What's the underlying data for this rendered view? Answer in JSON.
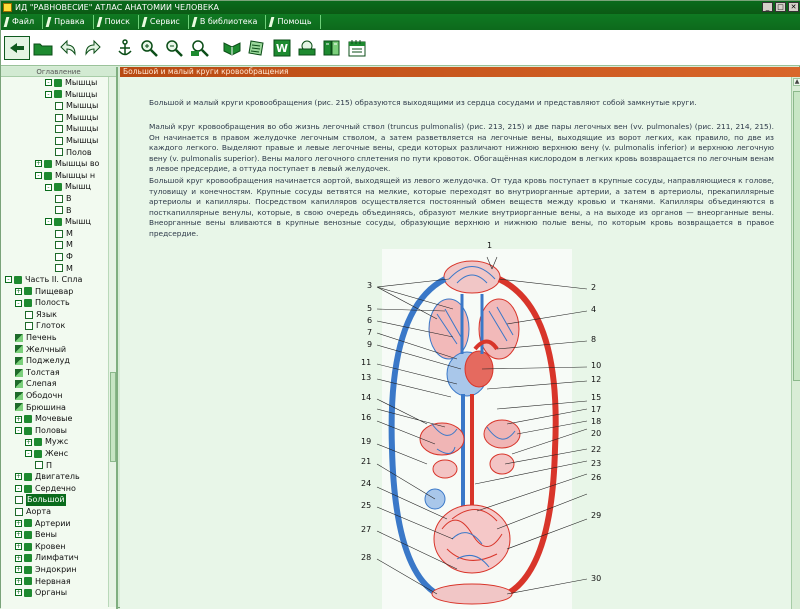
{
  "window": {
    "title": "ИД \"РАВНОВЕСИЕ\" АТЛАС АНАТОМИИ ЧЕЛОВЕКА",
    "minimize": "_",
    "maximize": "□",
    "close": "✕"
  },
  "menu": [
    "Файл",
    "Правка",
    "Поиск",
    "Сервис",
    "В библиотека",
    "Помощь"
  ],
  "toolbar": {
    "icons": [
      "exit-icon",
      "folder-open-icon",
      "back-icon",
      "forward-icon",
      "anchor-icon",
      "zoom-in-icon",
      "zoom-out-icon",
      "search-icon",
      "book-icon",
      "notes-icon",
      "word-icon",
      "print-icon",
      "library-icon",
      "calendar-icon"
    ]
  },
  "sidebar": {
    "header": "Оглавление",
    "items": [
      {
        "label": "Мышцы",
        "level": 4,
        "icon": "folder",
        "expand": "-"
      },
      {
        "label": "Мышцы",
        "level": 4,
        "icon": "folder",
        "expand": "-"
      },
      {
        "label": "Мышцы",
        "level": 5,
        "icon": "doc",
        "expand": ""
      },
      {
        "label": "Мышцы",
        "level": 5,
        "icon": "doc",
        "expand": ""
      },
      {
        "label": "Мышцы",
        "level": 5,
        "icon": "doc",
        "expand": ""
      },
      {
        "label": "Мышцы",
        "level": 5,
        "icon": "doc",
        "expand": ""
      },
      {
        "label": "Полов",
        "level": 5,
        "icon": "doc",
        "expand": ""
      },
      {
        "label": "Мышцы во",
        "level": 3,
        "icon": "folder",
        "expand": "+"
      },
      {
        "label": "Мышцы н",
        "level": 3,
        "icon": "folder",
        "expand": "-"
      },
      {
        "label": "Мышц",
        "level": 4,
        "icon": "folder",
        "expand": "-"
      },
      {
        "label": "В",
        "level": 5,
        "icon": "doc",
        "expand": ""
      },
      {
        "label": "В",
        "level": 5,
        "icon": "doc",
        "expand": ""
      },
      {
        "label": "Мышц",
        "level": 4,
        "icon": "folder",
        "expand": "-"
      },
      {
        "label": "М",
        "level": 5,
        "icon": "doc",
        "expand": ""
      },
      {
        "label": "М",
        "level": 5,
        "icon": "doc",
        "expand": ""
      },
      {
        "label": "Ф",
        "level": 5,
        "icon": "doc",
        "expand": ""
      },
      {
        "label": "М",
        "level": 5,
        "icon": "doc",
        "expand": ""
      },
      {
        "label": "Часть II. Спла",
        "level": 0,
        "icon": "folder",
        "expand": "-"
      },
      {
        "label": "Пищевар",
        "level": 1,
        "icon": "folder",
        "expand": "+"
      },
      {
        "label": "Полость",
        "level": 1,
        "icon": "folder",
        "expand": "-"
      },
      {
        "label": "Язык",
        "level": 2,
        "icon": "doc",
        "expand": ""
      },
      {
        "label": "Глоток",
        "level": 2,
        "icon": "doc",
        "expand": ""
      },
      {
        "label": "Печень",
        "level": 1,
        "icon": "hour",
        "expand": ""
      },
      {
        "label": "Желчный",
        "level": 1,
        "icon": "hour",
        "expand": ""
      },
      {
        "label": "Поджелуд",
        "level": 1,
        "icon": "hour",
        "expand": ""
      },
      {
        "label": "Толстая",
        "level": 1,
        "icon": "hour",
        "expand": ""
      },
      {
        "label": "Слепая",
        "level": 1,
        "icon": "hour",
        "expand": ""
      },
      {
        "label": "Ободочн",
        "level": 1,
        "icon": "hour",
        "expand": ""
      },
      {
        "label": "Брюшина",
        "level": 1,
        "icon": "hour",
        "expand": ""
      },
      {
        "label": "Мочевые",
        "level": 1,
        "icon": "folder",
        "expand": "+"
      },
      {
        "label": "Половы",
        "level": 1,
        "icon": "folder",
        "expand": "-"
      },
      {
        "label": "Мужс",
        "level": 2,
        "icon": "folder",
        "expand": "+"
      },
      {
        "label": "Женс",
        "level": 2,
        "icon": "folder",
        "expand": "-"
      },
      {
        "label": "П",
        "level": 3,
        "icon": "doc",
        "expand": ""
      },
      {
        "label": "Двигатель",
        "level": 1,
        "icon": "folder",
        "expand": "+"
      },
      {
        "label": "Сердечно",
        "level": 1,
        "icon": "folder",
        "expand": "-"
      },
      {
        "label": "Большой",
        "level": 1,
        "icon": "doc",
        "expand": "",
        "selected": true
      },
      {
        "label": "Аорта",
        "level": 1,
        "icon": "doc",
        "expand": ""
      },
      {
        "label": "Артерии",
        "level": 1,
        "icon": "folder",
        "expand": "+"
      },
      {
        "label": "Вены",
        "level": 1,
        "icon": "folder",
        "expand": "+"
      },
      {
        "label": "Кровен",
        "level": 1,
        "icon": "folder",
        "expand": "+"
      },
      {
        "label": "Лимфатич",
        "level": 1,
        "icon": "folder",
        "expand": "+"
      },
      {
        "label": "Эндокрин",
        "level": 1,
        "icon": "folder",
        "expand": "+"
      },
      {
        "label": "Нервная",
        "level": 1,
        "icon": "folder",
        "expand": "+"
      },
      {
        "label": "Органы",
        "level": 1,
        "icon": "folder",
        "expand": "+"
      }
    ]
  },
  "content": {
    "header": "Большой и малый круги кровообращения",
    "paragraphs": [
      "Большой и малый круги кровообращения (рис. 215) образуются выходящими из сердца сосудами и представляют собой замкнутые круги.",
      "Малый круг кровообращения во обо жизнь легочный ствол (truncus pulmonalis) (рис. 213, 215) и две пары легочных вен (vv. pulmonales) (рис. 211, 214, 215). Он начинается в правом желудочке легочным стволом, а затем разветвляется на легочные вены, выходящие из ворот легких, как правило, по две из каждого легкого. Выделяют правые и левые легочные вены, среди которых различают нижнюю верхнюю вену (v. pulmonalis inferior) и верхнюю легочную вену (v. pulmonalis superior). Вены малого легочного сплетения по пути кровоток. Обогащённая кислородом в легких кровь возвращается по легочным венам в левое предсердие, а оттуда поступает в левый желудочек.",
      "Большой круг кровообращения начинается аортой, выходящей из левого желудочка. От туда кровь поступает в крупные сосуды, направляющиеся к голове, туловищу и конечностям. Крупные сосуды ветвятся на мелкие, которые переходят во внутриорганные артерии, а затем в артериолы, прекапиллярные артериолы и капилляры. Посредством капилляров осуществляется постоянный обмен веществ между кровью и тканями. Капилляры объединяются в посткапиллярные венулы, которые, в свою очередь объединяясь, образуют мелкие внутриорганные вены, а на выходе из органов — внеорганные вены. Внеорганные вены вливаются в крупные венозные сосуды, образующие верхнюю и нижнюю полые вены, по которым кровь возвращается в правое предсердие."
    ],
    "figure_labels": [
      "1",
      "2",
      "3",
      "4",
      "5",
      "6",
      "7",
      "8",
      "9",
      "10",
      "11",
      "12",
      "13",
      "14",
      "15",
      "16",
      "17",
      "18",
      "19",
      "20",
      "21",
      "22",
      "23",
      "24",
      "25",
      "26",
      "27",
      "28",
      "29",
      "30"
    ]
  },
  "colors": {
    "title_green": "#0a6b1c",
    "header_orange": "#c9571c",
    "artery_red": "#d8352a",
    "vein_blue": "#3a78c8",
    "content_bg": "#e8f6e8"
  }
}
